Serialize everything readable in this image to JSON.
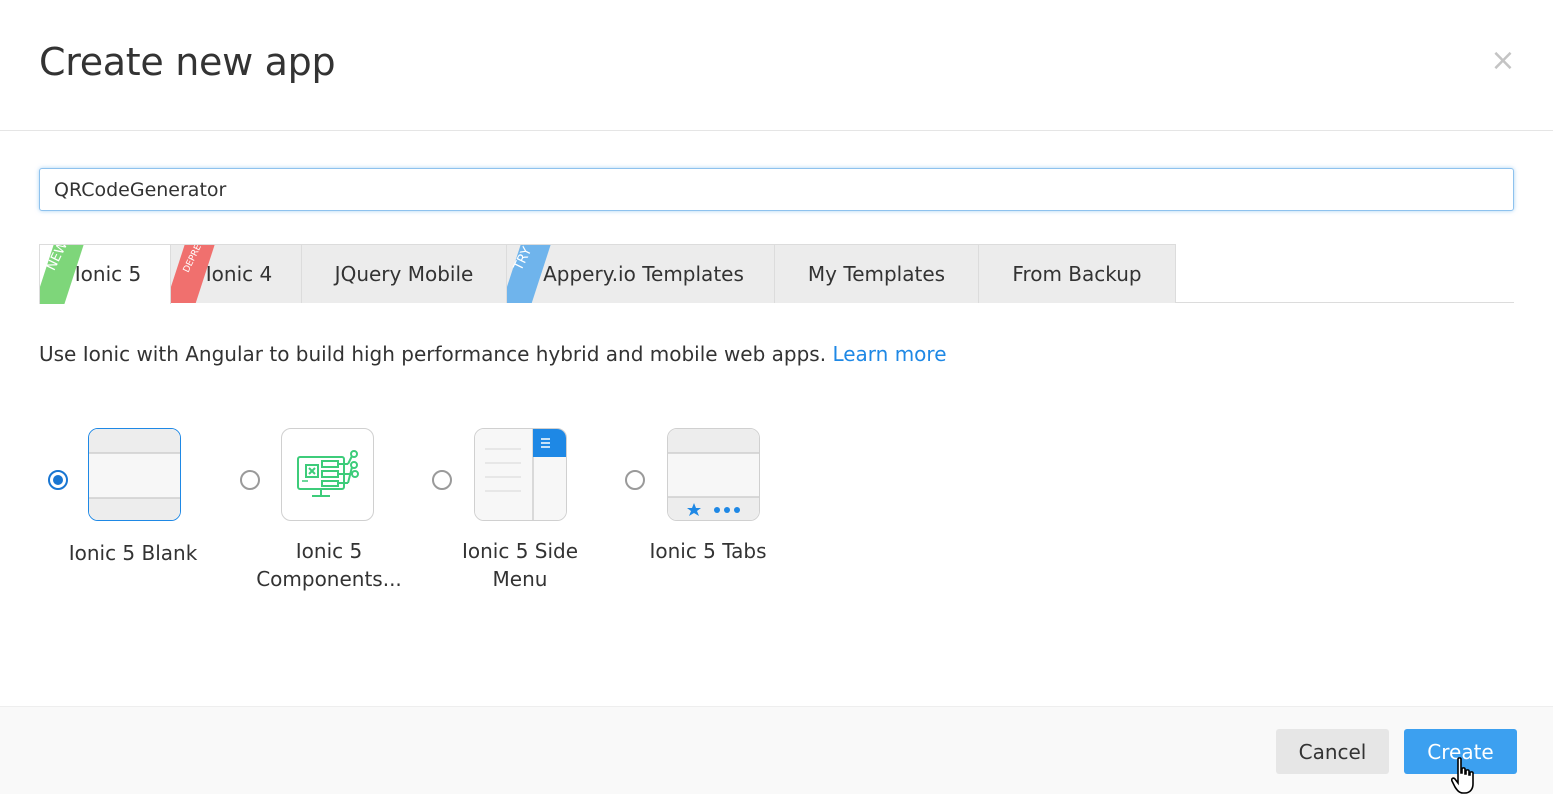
{
  "dialog": {
    "title": "Create new app",
    "close_glyph": "×"
  },
  "app_name": {
    "value": "QRCodeGenerator"
  },
  "tabs": [
    {
      "label": "Ionic 5",
      "badge": "NEW",
      "active": true
    },
    {
      "label": "Ionic 4",
      "badge": "DEPRECATED",
      "active": false
    },
    {
      "label": "JQuery Mobile",
      "badge": "",
      "active": false
    },
    {
      "label": "Appery.io Templates",
      "badge": "TRY",
      "active": false
    },
    {
      "label": "My Templates",
      "badge": "",
      "active": false
    },
    {
      "label": "From Backup",
      "badge": "",
      "active": false
    }
  ],
  "description": {
    "text": "Use Ionic with Angular to build high performance hybrid and mobile web apps. ",
    "link": "Learn more"
  },
  "templates": [
    {
      "label": "Ionic 5 Blank",
      "selected": true,
      "icon": "blank-template-icon"
    },
    {
      "label": "Ionic 5 Components...",
      "selected": false,
      "icon": "components-template-icon"
    },
    {
      "label": "Ionic 5 Side Menu",
      "selected": false,
      "icon": "side-menu-template-icon"
    },
    {
      "label": "Ionic 5 Tabs",
      "selected": false,
      "icon": "tabs-template-icon"
    }
  ],
  "footer": {
    "cancel_label": "Cancel",
    "create_label": "Create"
  },
  "colors": {
    "accent": "#3ca0f0",
    "link": "#1e88e5",
    "badge_new": "#7ed67a",
    "badge_deprecated": "#f0706e",
    "badge_try": "#6fb4ec",
    "components_icon": "#3dcc7a"
  }
}
